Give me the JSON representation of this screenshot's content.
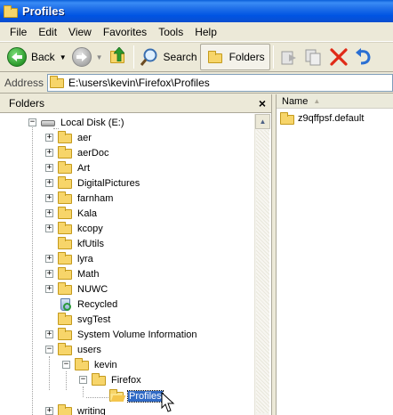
{
  "window": {
    "title": "Profiles"
  },
  "menu": [
    "File",
    "Edit",
    "View",
    "Favorites",
    "Tools",
    "Help"
  ],
  "toolbar": {
    "back_label": "Back",
    "search_label": "Search",
    "folders_label": "Folders"
  },
  "address": {
    "label": "Address",
    "value": "E:\\users\\kevin\\Firefox\\Profiles"
  },
  "folders_pane": {
    "title": "Folders",
    "close": "×",
    "tree": [
      {
        "label": "Local Disk (E:)",
        "expander": "−"
      },
      {
        "label": "aer",
        "expander": "+"
      },
      {
        "label": "aerDoc",
        "expander": "+"
      },
      {
        "label": "Art",
        "expander": "+"
      },
      {
        "label": "DigitalPictures",
        "expander": "+"
      },
      {
        "label": "farnham",
        "expander": "+"
      },
      {
        "label": "Kala",
        "expander": "+"
      },
      {
        "label": "kcopy",
        "expander": "+"
      },
      {
        "label": "kfUtils",
        "expander": ""
      },
      {
        "label": "lyra",
        "expander": "+"
      },
      {
        "label": "Math",
        "expander": "+"
      },
      {
        "label": "NUWC",
        "expander": "+"
      },
      {
        "label": "Recycled",
        "expander": ""
      },
      {
        "label": "svgTest",
        "expander": ""
      },
      {
        "label": "System Volume Information",
        "expander": "+"
      },
      {
        "label": "users",
        "expander": "−"
      },
      {
        "label": "kevin",
        "expander": "−"
      },
      {
        "label": "Firefox",
        "expander": "−"
      },
      {
        "label": "Profiles",
        "expander": ""
      },
      {
        "label": "writing",
        "expander": "+"
      }
    ]
  },
  "content_pane": {
    "column_name": "Name",
    "items": [
      {
        "label": "z9qffpsf.default"
      }
    ]
  }
}
